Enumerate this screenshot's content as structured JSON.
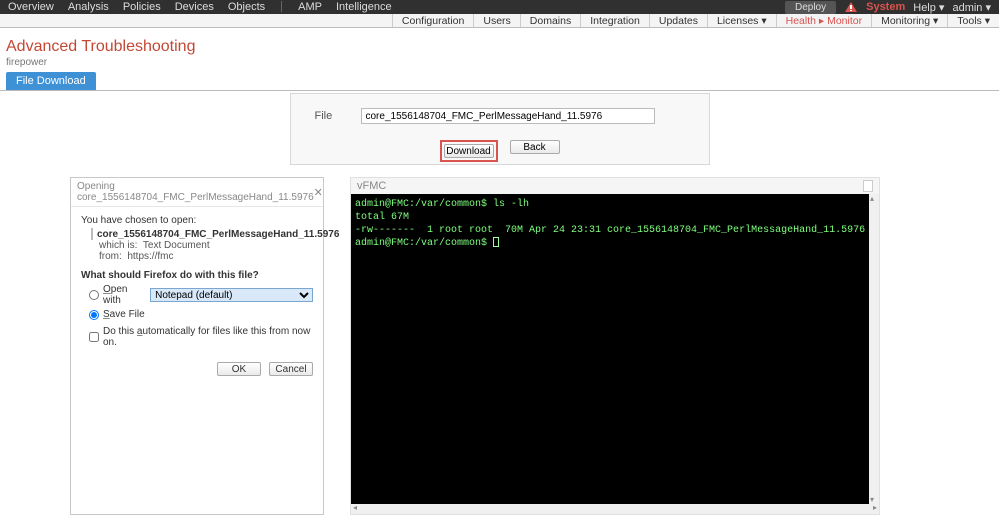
{
  "top": {
    "left": [
      "Overview",
      "Analysis",
      "Policies",
      "Devices",
      "Objects",
      "AMP",
      "Intelligence"
    ],
    "deploy": "Deploy",
    "system": "System",
    "help": "Help ▾",
    "admin": "admin ▾"
  },
  "sub": [
    "Configuration",
    "Users",
    "Domains",
    "Integration",
    "Updates",
    "Licenses ▾",
    "Health  ▸ Monitor",
    "Monitoring ▾",
    "Tools ▾"
  ],
  "page": {
    "title": "Advanced Troubleshooting",
    "subtitle": "firepower",
    "tab": "File Download"
  },
  "filebox": {
    "label": "File",
    "value": "core_1556148704_FMC_PerlMessageHand_11.5976",
    "download": "Download",
    "back": "Back"
  },
  "dialog": {
    "title": "Opening core_1556148704_FMC_PerlMessageHand_11.5976",
    "chosen": "You have chosen to open:",
    "filename": "core_1556148704_FMC_PerlMessageHand_11.5976",
    "which_label": "which is:",
    "which_value": "Text Document",
    "from_label": "from:",
    "from_value": "https://fmc",
    "question": "What should Firefox do with this file?",
    "open_with": "Open with",
    "open_app": "Notepad (default)",
    "save_file": "Save File",
    "auto": "Do this automatically for files like this from now on.",
    "ok": "OK",
    "cancel": "Cancel"
  },
  "term": {
    "title": "vFMC",
    "lines": [
      "admin@FMC:/var/common$ ls -lh",
      "total 67M",
      "-rw-------  1 root root  70M Apr 24 23:31 core_1556148704_FMC_PerlMessageHand_11.5976",
      "admin@FMC:/var/common$ "
    ]
  }
}
